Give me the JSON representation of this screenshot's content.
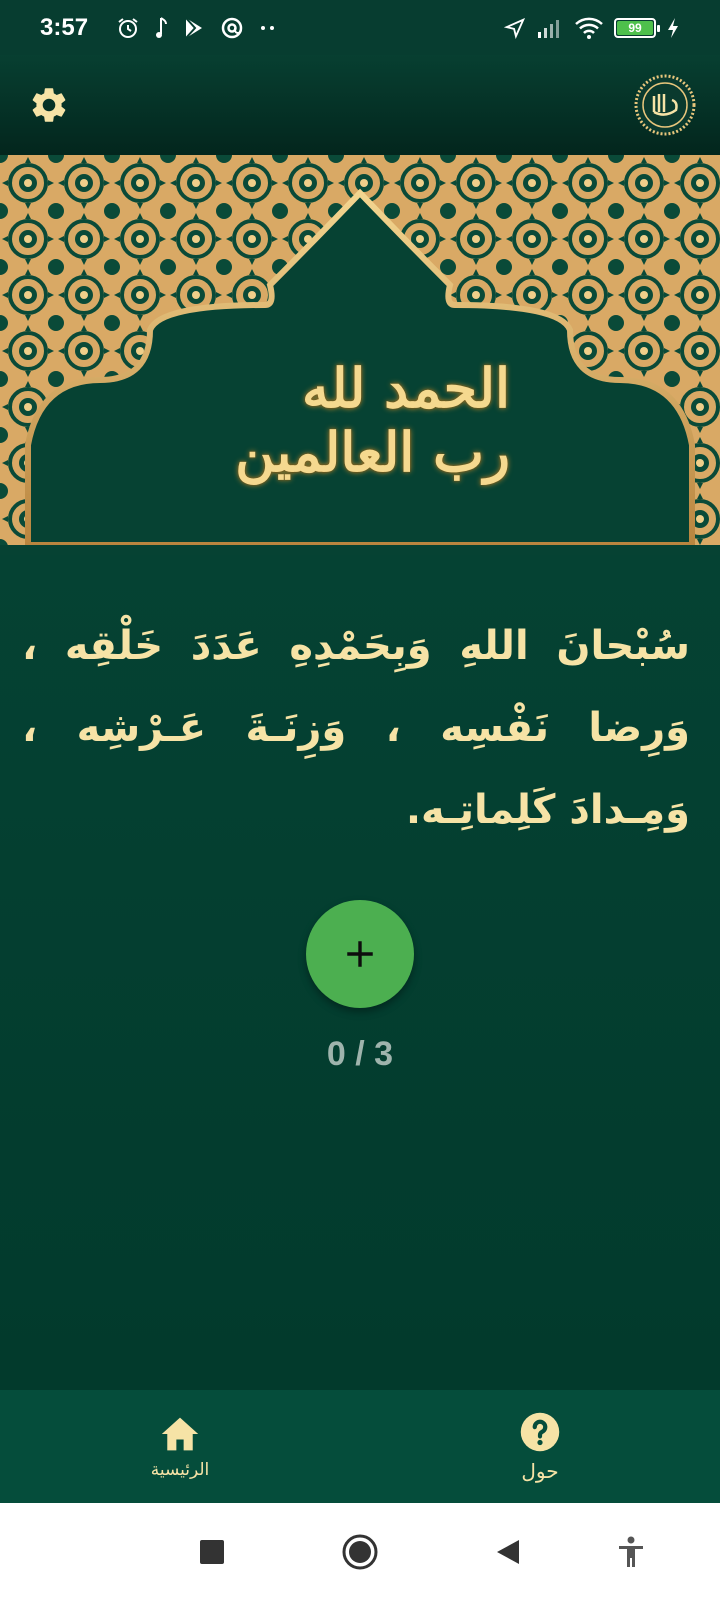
{
  "status_bar": {
    "time": "3:57",
    "battery_level": "99",
    "icons": [
      "alarm-icon",
      "music-note-icon",
      "play-store-icon",
      "at-sign-icon",
      "more-dots-icon",
      "location-arrow-icon",
      "signal-icon",
      "wifi-icon",
      "battery-icon",
      "charging-icon"
    ]
  },
  "app_bar": {
    "settings_icon": "gear-icon",
    "logo": "allah-calligraphy-logo"
  },
  "hero": {
    "calligraphy_text": "الحمد لله رب العالمين"
  },
  "dhikr": {
    "text": "سُبْحانَ اللهِ وَبِحَمْدِهِ عَدَدَ خَلْقِه ، وَرِضا نَفْسِه ، وَزِنَـةَ عَـرْشِه ، وَمِـدادَ كَلِماتِـه."
  },
  "counter": {
    "display": "0 / 3",
    "current": 0,
    "target": 3
  },
  "add_button": {
    "icon": "plus-icon"
  },
  "bottom_nav": {
    "items": [
      {
        "label": "الرئيسية",
        "icon": "home-icon"
      },
      {
        "label": "حول",
        "icon": "help-circle-icon"
      }
    ]
  },
  "system_nav": {
    "buttons": [
      "recents-square-icon",
      "home-circle-icon",
      "back-triangle-icon",
      "accessibility-icon"
    ]
  },
  "colors": {
    "primary_dark": "#054233",
    "gold": "#f6e3a6",
    "fab_green": "#4caf50",
    "counter_gray": "#9fb4ad",
    "bottom_nav": "#054d3b"
  }
}
